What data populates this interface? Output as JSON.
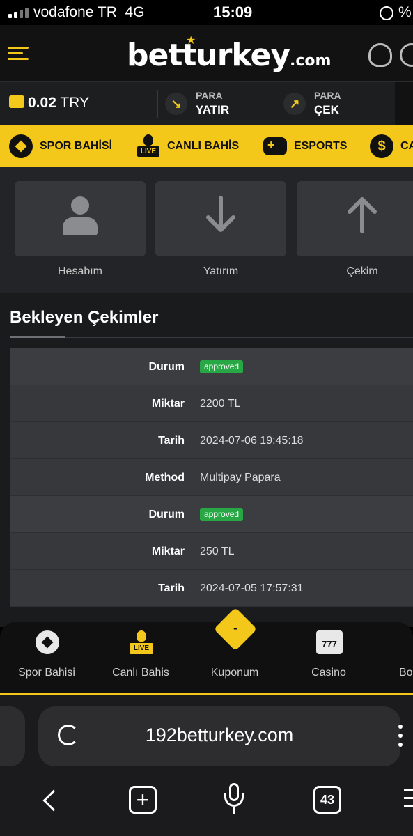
{
  "status_bar": {
    "carrier": "vodafone TR",
    "network": "4G",
    "time": "15:09",
    "battery": "%"
  },
  "header": {
    "logo_main": "betturkey",
    "logo_suffix": ".com"
  },
  "balance": {
    "amount": "0.02",
    "currency": "TRY"
  },
  "pay_buttons": [
    {
      "line1": "PARA",
      "line2": "YATIR"
    },
    {
      "line1": "PARA",
      "line2": "ÇEK"
    }
  ],
  "categories": [
    {
      "label": "SPOR BAHİSİ",
      "icon": "soccer-ball-icon"
    },
    {
      "label": "CANLI BAHİS",
      "icon": "live-icon",
      "badge": "LIVE"
    },
    {
      "label": "ESPORTS",
      "icon": "gamepad-icon"
    },
    {
      "label": "CA",
      "icon": "casino-coin-icon"
    }
  ],
  "account_tiles": [
    {
      "label": "Hesabım",
      "icon": "user-icon"
    },
    {
      "label": "Yatırım",
      "icon": "arrow-down-icon"
    },
    {
      "label": "Çekim",
      "icon": "arrow-up-icon"
    }
  ],
  "section": {
    "title": "Bekleyen Çekimler"
  },
  "withdrawals": [
    {
      "status_label": "Durum",
      "status": "approved",
      "amount_label": "Miktar",
      "amount": "2200 TL",
      "date_label": "Tarih",
      "date": "2024-07-06 19:45:18",
      "method_label": "Method",
      "method": "Multipay Papara"
    },
    {
      "status_label": "Durum",
      "status": "approved",
      "amount_label": "Miktar",
      "amount": "250 TL",
      "date_label": "Tarih",
      "date": "2024-07-05 17:57:31"
    }
  ],
  "bottom_nav": [
    {
      "label": "Spor Bahisi",
      "icon": "soccer-ball-icon"
    },
    {
      "label": "Canlı Bahis",
      "icon": "live-icon",
      "badge": "LIVE"
    },
    {
      "label": "Kuponum",
      "icon": "coupon-icon",
      "badge": "-"
    },
    {
      "label": "Casino",
      "icon": "slot-777-icon",
      "badge": "777"
    },
    {
      "label": "Bo",
      "icon": "bonus-icon"
    }
  ],
  "browser": {
    "url": "192betturkey.com",
    "tab_count": "43"
  },
  "colors": {
    "accent": "#f4c81a",
    "approved": "#27a844",
    "background": "#1a1b1d"
  }
}
